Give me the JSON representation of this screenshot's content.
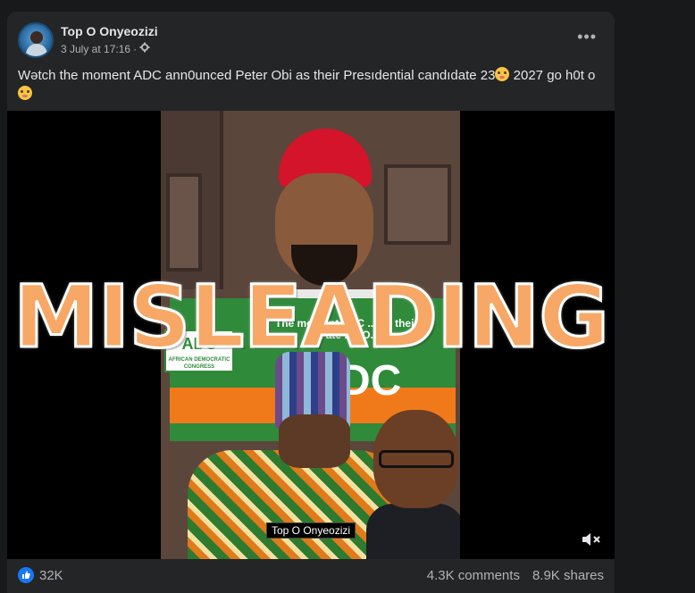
{
  "post": {
    "author": "Top O Onyeozizi",
    "timestamp": "3 July at 17:16",
    "separator": "·",
    "more_label": "•••",
    "caption_part1": "Wətch the moment ADC ann0unced Peter Obi as their Presıdential candıdate 23",
    "caption_part2": "  2027 go h0t o"
  },
  "video": {
    "overlay_label": "MISLEADING",
    "banner_text_line1": "The moment ADC ... ed their",
    "banner_text_line2": "... ate P... O...",
    "logo_text": "ADC",
    "logo_subtext": "AFRICAN DEMOCRATIC CONGRESS",
    "banner_large_text": "DC",
    "name_tag": "Top O Onyeozizi",
    "volume_icon": "muted-speaker-icon"
  },
  "footer": {
    "reactions_count": "32K",
    "comments": "4.3K comments",
    "shares": "8.9K shares"
  },
  "colors": {
    "background": "#18191a",
    "card": "#242526",
    "overlay_fill": "#f7a866",
    "like_blue": "#1877f2"
  }
}
